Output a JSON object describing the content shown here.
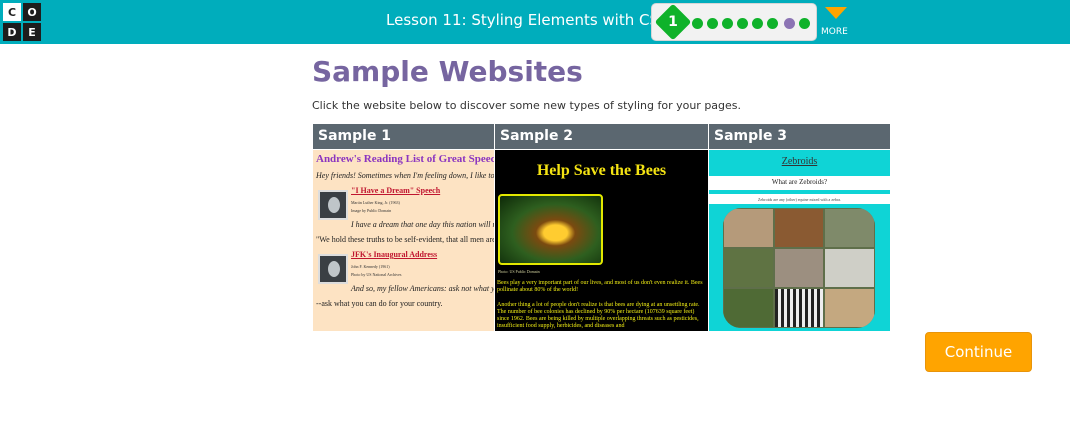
{
  "logo": {
    "letters": [
      "C",
      "O",
      "D",
      "E"
    ]
  },
  "header": {
    "lesson_title": "Lesson 11: Styling Elements with CSS",
    "progress": {
      "current_level": "1",
      "dot_colors": [
        "#0fb22a",
        "#0fb22a",
        "#0fb22a",
        "#0fb22a",
        "#0fb22a",
        "#0fb22a",
        "#8c74b4",
        "#0fb22a"
      ]
    },
    "more_label": "MORE"
  },
  "main": {
    "title": "Sample Websites",
    "instructions": "Click the website below to discover some new types of styling for your pages.",
    "samples": [
      {
        "label": "Sample 1",
        "preview": {
          "heading": "Andrew's Reading List of Great Speeches",
          "intro": "Hey friends! Sometimes when I'm feeling down, I like to read",
          "link1": "\"I Have a Dream\" Speech",
          "link1_meta": "Martin Luther King, Jr. (1963)",
          "link1_meta2": "Image by Public Domain",
          "quote1": "I have a dream that one day this nation will rise u",
          "quote1b": "\"We hold these truths to be self-evident, that all men are creat",
          "link2": "JFK's Inaugural Address",
          "link2_meta": "John F. Kennedy (1961)",
          "link2_meta2": "Photo by US National Archives",
          "quote2": "And so, my fellow Americans: ask not what your",
          "quote2b": "--ask what you can do for your country."
        }
      },
      {
        "label": "Sample 2",
        "preview": {
          "heading": "Help Save the Bees",
          "caption": "Photo: US Public Domain",
          "para1": "Bees play a very important part of our lives, and most of us don't even realize it. Bees pollinate about 80% of the world!",
          "para2": "Another thing a lot of people don't realize is that bees are dying at an unsettling rate. The number of bee colonies has declined by 90% per hectare (107639 square feet) since 1962. Bees are being killed by multiple overlapping threats such as pesticides, insufficient food supply, herbicides, and diseases and"
        }
      },
      {
        "label": "Sample 3",
        "preview": {
          "heading": "Zebroids",
          "question": "What are Zebroids?",
          "strip": "Zebroids are any (other) equine mixed with a zebra."
        }
      }
    ]
  },
  "continue_label": "Continue"
}
